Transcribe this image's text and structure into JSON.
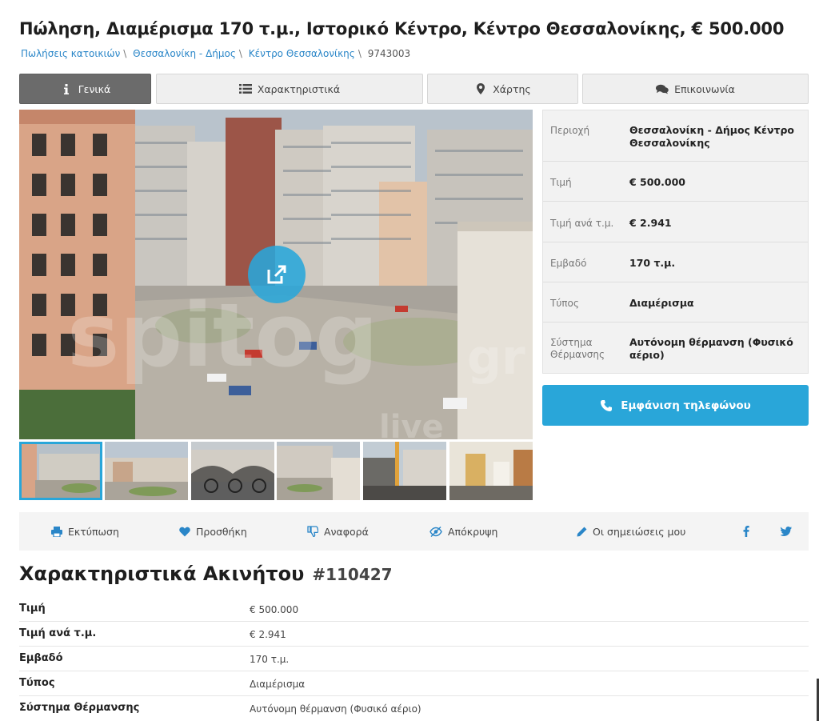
{
  "listing": {
    "title": "Πώληση, Διαμέρισμα 170 τ.μ., Ιστορικό Κέντρο, Κέντρο Θεσσαλονίκης, € 500.000",
    "breadcrumbs": [
      "Πωλήσεις κατοικιών",
      "Θεσσαλονίκη - Δήμος",
      "Κέντρο Θεσσαλονίκης",
      "9743003"
    ]
  },
  "tabs": [
    {
      "label": "Γενικά",
      "icon": "info-icon",
      "active": true
    },
    {
      "label": "Χαρακτηριστικά",
      "icon": "list-icon",
      "active": false
    },
    {
      "label": "Χάρτης",
      "icon": "map-marker-icon",
      "active": false
    },
    {
      "label": "Επικοινωνία",
      "icon": "chat-icon",
      "active": false
    }
  ],
  "gallery": {
    "expand_icon": "external-link-icon",
    "watermark": "spitogatos 24h live",
    "thumbnails": 6,
    "selected_thumbnail": 1
  },
  "summary": [
    {
      "key": "Περιοχή",
      "value": "Θεσσαλονίκη - Δήμος Κέντρο Θεσσαλονίκης"
    },
    {
      "key": "Τιμή",
      "value": "€ 500.000"
    },
    {
      "key": "Τιμή ανά τ.μ.",
      "value": "€ 2.941"
    },
    {
      "key": "Εμβαδό",
      "value": "170 τ.μ."
    },
    {
      "key": "Τύπος",
      "value": "Διαμέρισμα"
    },
    {
      "key": "Σύστημα Θέρμανσης",
      "value": "Αυτόνομη θέρμανση (Φυσικό αέριο)"
    }
  ],
  "phone_button": {
    "label": "Εμφάνιση τηλεφώνου",
    "icon": "phone-icon"
  },
  "actions": [
    {
      "label": "Εκτύπωση",
      "icon": "print-icon"
    },
    {
      "label": "Προσθήκη",
      "icon": "heart-icon"
    },
    {
      "label": "Αναφορά",
      "icon": "thumbs-down-icon"
    },
    {
      "label": "Απόκρυψη",
      "icon": "eye-slash-icon"
    },
    {
      "label": "Οι σημειώσεις μου",
      "icon": "pencil-icon"
    }
  ],
  "social": [
    "facebook-icon",
    "twitter-icon"
  ],
  "features": {
    "heading": "Χαρακτηριστικά Ακινήτου",
    "id": "#110427",
    "rows": [
      {
        "key": "Τιμή",
        "value": "€ 500.000"
      },
      {
        "key": "Τιμή ανά τ.μ.",
        "value": "€ 2.941"
      },
      {
        "key": "Εμβαδό",
        "value": "170 τ.μ."
      },
      {
        "key": "Τύπος",
        "value": "Διαμέρισμα"
      },
      {
        "key": "Σύστημα Θέρμανσης",
        "value": "Αυτόνομη θέρμανση (Φυσικό αέριο)"
      }
    ]
  },
  "colors": {
    "accent": "#29a6d9",
    "link": "#2a86c8",
    "active_tab": "#6b6b6b"
  }
}
